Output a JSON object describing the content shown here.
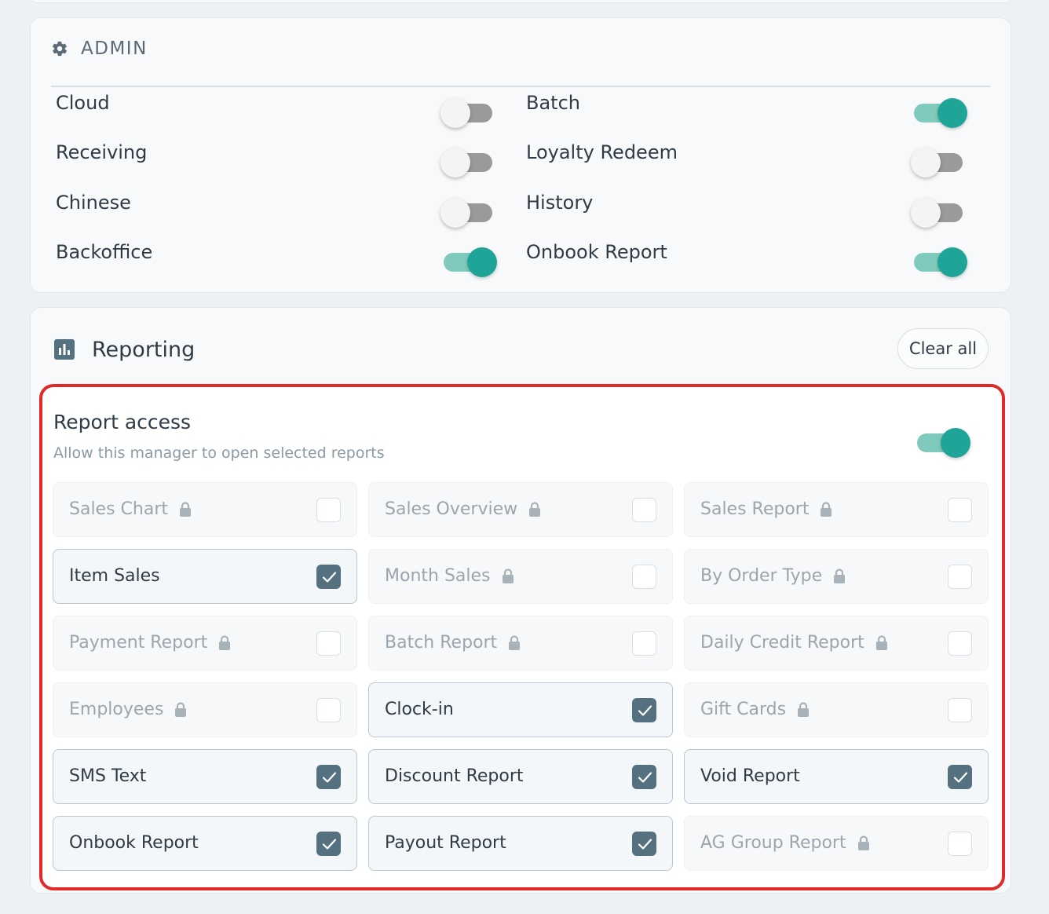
{
  "admin": {
    "title": "ADMIN",
    "toggles_left": [
      {
        "label": "Cloud",
        "on": false
      },
      {
        "label": "Receiving",
        "on": false
      },
      {
        "label": "Chinese",
        "on": false
      },
      {
        "label": "Backoffice",
        "on": true
      }
    ],
    "toggles_right": [
      {
        "label": "Batch",
        "on": true
      },
      {
        "label": "Loyalty Redeem",
        "on": false
      },
      {
        "label": "History",
        "on": false
      },
      {
        "label": "Onbook Report",
        "on": true
      }
    ]
  },
  "reporting": {
    "title": "Reporting",
    "clear_label": "Clear all",
    "access": {
      "title": "Report access",
      "subtitle": "Allow this manager to open selected reports",
      "on": true
    },
    "reports": [
      {
        "label": "Sales Chart",
        "locked": true,
        "checked": false
      },
      {
        "label": "Sales Overview",
        "locked": true,
        "checked": false
      },
      {
        "label": "Sales Report",
        "locked": true,
        "checked": false
      },
      {
        "label": "Item Sales",
        "locked": false,
        "checked": true
      },
      {
        "label": "Month Sales",
        "locked": true,
        "checked": false
      },
      {
        "label": "By Order Type",
        "locked": true,
        "checked": false
      },
      {
        "label": "Payment Report",
        "locked": true,
        "checked": false
      },
      {
        "label": "Batch Report",
        "locked": true,
        "checked": false
      },
      {
        "label": "Daily Credit Report",
        "locked": true,
        "checked": false
      },
      {
        "label": "Employees",
        "locked": true,
        "checked": false
      },
      {
        "label": "Clock-in",
        "locked": false,
        "checked": true
      },
      {
        "label": "Gift Cards",
        "locked": true,
        "checked": false
      },
      {
        "label": "SMS Text",
        "locked": false,
        "checked": true
      },
      {
        "label": "Discount Report",
        "locked": false,
        "checked": true
      },
      {
        "label": "Void Report",
        "locked": false,
        "checked": true
      },
      {
        "label": "Onbook Report",
        "locked": false,
        "checked": true
      },
      {
        "label": "Payout Report",
        "locked": false,
        "checked": true
      },
      {
        "label": "AG Group Report",
        "locked": true,
        "checked": false
      }
    ]
  },
  "colors": {
    "accent": "#1fa597",
    "accent_track": "#80c9bd",
    "checkbox_checked": "#55707f",
    "highlight_border": "#e02a2a"
  }
}
